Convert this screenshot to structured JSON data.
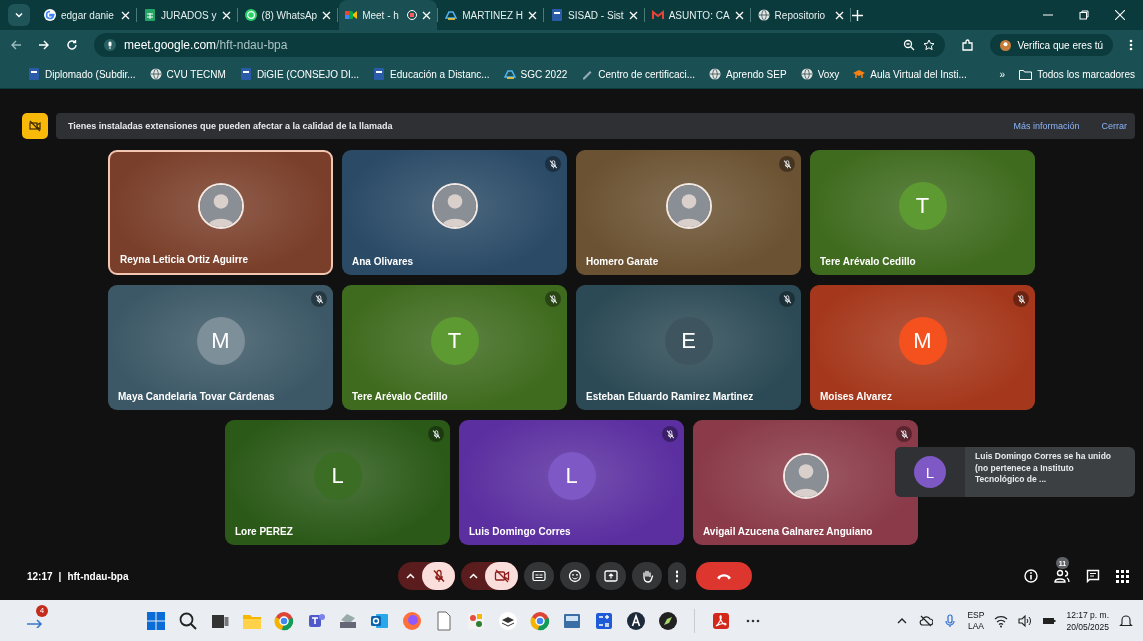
{
  "browser": {
    "tabs": [
      {
        "label": "edgar danie",
        "kind": "google",
        "selected": false,
        "recording": false
      },
      {
        "label": "JURADOS y",
        "kind": "sheets",
        "selected": false,
        "recording": false
      },
      {
        "label": "(8) WhatsAp",
        "kind": "whatsapp",
        "selected": false,
        "recording": false
      },
      {
        "label": "Meet - h",
        "kind": "meet",
        "selected": true,
        "recording": true
      },
      {
        "label": "MARTINEZ H",
        "kind": "drive",
        "selected": false,
        "recording": false
      },
      {
        "label": "SISAD - Sist",
        "kind": "site",
        "selected": false,
        "recording": false
      },
      {
        "label": "ASUNTO: CA",
        "kind": "gmail",
        "selected": false,
        "recording": false
      },
      {
        "label": "Repositorio",
        "kind": "globe",
        "selected": false,
        "recording": false
      }
    ],
    "url_host": "meet.google.com",
    "url_path": "/hft-ndau-bpa",
    "profile_label": "Verifica que eres tú",
    "bookmarks": [
      {
        "label": "Diplomado (Subdir...",
        "kind": "site"
      },
      {
        "label": "CVU TECNM",
        "kind": "globe"
      },
      {
        "label": "DiGIE (CONSEJO DI...",
        "kind": "site"
      },
      {
        "label": "Educación a Distanc...",
        "kind": "site"
      },
      {
        "label": "SGC 2022",
        "kind": "drive"
      },
      {
        "label": "Centro de certificaci...",
        "kind": "pen"
      },
      {
        "label": "Aprendo SEP",
        "kind": "globe"
      },
      {
        "label": "Voxy",
        "kind": "globe"
      },
      {
        "label": "Aula Virtual del Insti...",
        "kind": "moodle"
      }
    ],
    "more_bookmarks": "»",
    "all_bookmarks": "Todos los marcadores"
  },
  "banner": {
    "text": "Tienes instaladas extensiones que pueden afectar a la calidad de la llamada",
    "link": "Más información",
    "close": "Cerrar"
  },
  "tile_rows": [
    [
      {
        "name": "Reyna Leticia Ortiz Aguirre",
        "kind": "photo",
        "color": "#7a3f2a",
        "muted": false,
        "highlighted": true
      },
      {
        "name": "Ana Olivares",
        "kind": "photo",
        "color": "#2a4a66",
        "muted": true,
        "highlighted": false
      },
      {
        "name": "Homero Garate",
        "kind": "photo",
        "color": "#6b5232",
        "muted": true,
        "highlighted": false
      },
      {
        "name": "Tere Arévalo Cedillo",
        "kind": "letter",
        "avatar": {
          "letter": "T",
          "color": "#5e9a32"
        },
        "color": "#3f6b1e",
        "muted": false,
        "highlighted": false
      }
    ],
    [
      {
        "name": "Maya Candelaria Tovar Cárdenas",
        "kind": "letter",
        "avatar": {
          "letter": "M",
          "color": "#7d8f98"
        },
        "color": "#3c5866",
        "muted": true,
        "highlighted": false
      },
      {
        "name": "Tere Arévalo Cedillo",
        "kind": "letter",
        "avatar": {
          "letter": "T",
          "color": "#5e9a32"
        },
        "color": "#3f6b1e",
        "muted": true,
        "highlighted": false
      },
      {
        "name": "Esteban Eduardo Ramirez Martinez",
        "kind": "letter",
        "avatar": {
          "letter": "E",
          "color": "#3e545e"
        },
        "color": "#2c4a55",
        "muted": true,
        "highlighted": false
      },
      {
        "name": "Moises Alvarez",
        "kind": "letter",
        "avatar": {
          "letter": "M",
          "color": "#f4511e"
        },
        "color": "#a5381c",
        "muted": true,
        "highlighted": false
      }
    ],
    [
      {
        "name": "Lore PEREZ",
        "kind": "letter",
        "avatar": {
          "letter": "L",
          "color": "#3b6d25"
        },
        "color": "#2b5a18",
        "muted": true,
        "highlighted": false
      },
      {
        "name": "Luis Domingo Corres",
        "kind": "letter",
        "avatar": {
          "letter": "L",
          "color": "#7e58c4"
        },
        "color": "#5b2fa0",
        "muted": true,
        "highlighted": false
      },
      {
        "name": "Avigail Azucena Galnarez Anguiano",
        "kind": "photo",
        "color": "#8a3a48",
        "muted": true,
        "highlighted": false
      }
    ]
  ],
  "toast": {
    "letter": "L",
    "color": "#7e58c4",
    "text": "Luis Domingo Corres se ha unido (no pertenece a Instituto Tecnológico de ..."
  },
  "controls": {
    "time": "12:17",
    "separator": "|",
    "meeting_code": "hft-ndau-bpa",
    "mic_on": false,
    "camera_on": false,
    "more": "⋮",
    "people_count": "11"
  },
  "taskbar": {
    "notification_count": "4",
    "language": "ESP",
    "layout": "LAA",
    "time": "12:17 p. m.",
    "date": "20/05/2025"
  }
}
